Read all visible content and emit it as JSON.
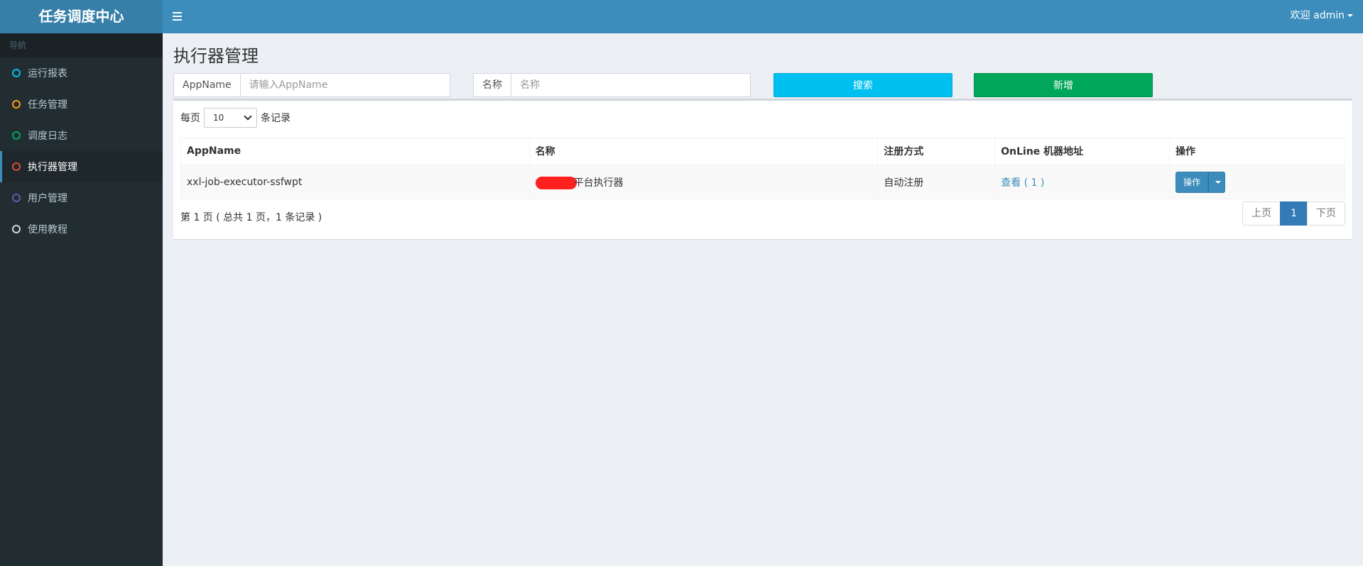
{
  "app": {
    "title": "任务调度中心"
  },
  "header": {
    "user_greeting": "欢迎 admin"
  },
  "sidebar": {
    "header": "导航",
    "items": [
      {
        "label": "运行报表",
        "color": "#00c0ef"
      },
      {
        "label": "任务管理",
        "color": "#f39c12"
      },
      {
        "label": "调度日志",
        "color": "#00a65a"
      },
      {
        "label": "执行器管理",
        "color": "#dd4b39"
      },
      {
        "label": "用户管理",
        "color": "#605ca8"
      },
      {
        "label": "使用教程",
        "color": "#d2d6de"
      }
    ]
  },
  "main": {
    "title": "执行器管理",
    "filters": {
      "appname_label": "AppName",
      "appname_placeholder": "请输入AppName",
      "name_label": "名称",
      "name_placeholder": "名称",
      "search_label": "搜索",
      "add_label": "新增"
    },
    "length": {
      "prefix": "每页",
      "value": "10",
      "suffix": "条记录"
    },
    "table": {
      "columns": [
        "AppName",
        "名称",
        "注册方式",
        "OnLine 机器地址",
        "操作"
      ],
      "rows": [
        {
          "appname": "xxl-job-executor-ssfwpt",
          "name": "平台执行器",
          "registry": "自动注册",
          "online": "查看 ( 1 )",
          "action": "操作"
        }
      ]
    },
    "info": "第 1 页 ( 总共 1 页，1 条记录 )",
    "pagination": {
      "prev": "上页",
      "current": "1",
      "next": "下页"
    }
  }
}
